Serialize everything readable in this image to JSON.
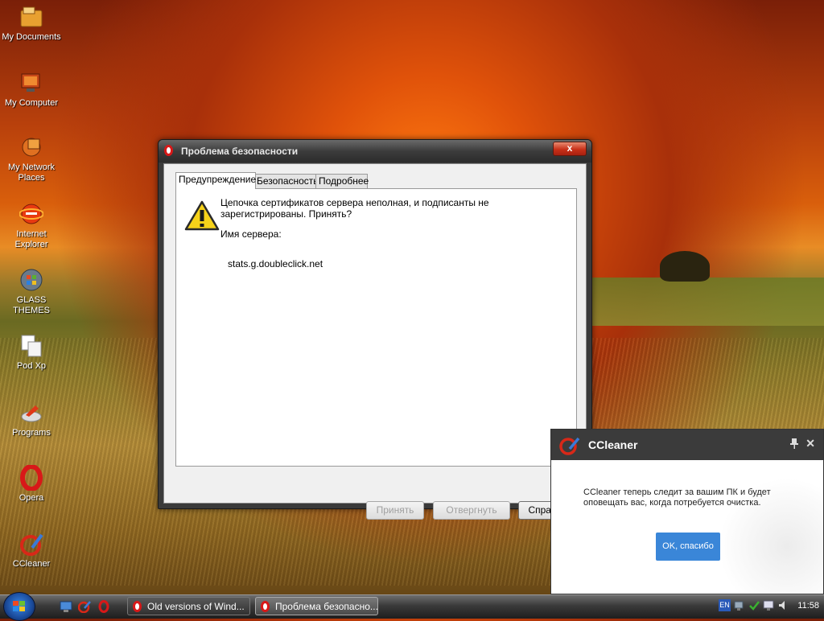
{
  "desktop": {
    "icons": [
      {
        "label": "My Documents"
      },
      {
        "label": "My Computer"
      },
      {
        "label": "My Network Places"
      },
      {
        "label": "Internet Explorer"
      },
      {
        "label": "GLASS THEMES"
      },
      {
        "label": "Pod Xp"
      },
      {
        "label": "Programs"
      },
      {
        "label": "Opera"
      },
      {
        "label": "CCleaner"
      }
    ]
  },
  "dialog": {
    "title": "Проблема безопасности",
    "close_glyph": "x",
    "tabs": [
      {
        "label": "Предупреждение",
        "active": true
      },
      {
        "label": "Безопасность",
        "active": false
      },
      {
        "label": "Подробнее",
        "active": false
      }
    ],
    "message": "Цепочка сертификатов сервера неполная, и подписанты не зарегистрированы. Принять?",
    "server_label": "Имя сервера:",
    "server_name": "stats.g.doubleclick.net",
    "buttons": {
      "accept": "Принять",
      "reject": "Отвергнуть",
      "help": "Справка"
    }
  },
  "ccleaner": {
    "title": "CCleaner",
    "message": "CCleaner теперь следит за вашим ПК и будет оповещать вас, когда потребуется очистка.",
    "ok": "OK, спасибо",
    "pin_icon": "pin-icon",
    "close_glyph": "✕"
  },
  "taskbar": {
    "tasks": [
      {
        "label": "Old versions of Wind..."
      },
      {
        "label": "Проблема безопасно..."
      }
    ],
    "tray": {
      "language": "EN",
      "time": "11:58"
    }
  },
  "colors": {
    "accent_red": "#d81818",
    "cc_button": "#3a86d8",
    "cc_header": "#3b3b3b"
  }
}
